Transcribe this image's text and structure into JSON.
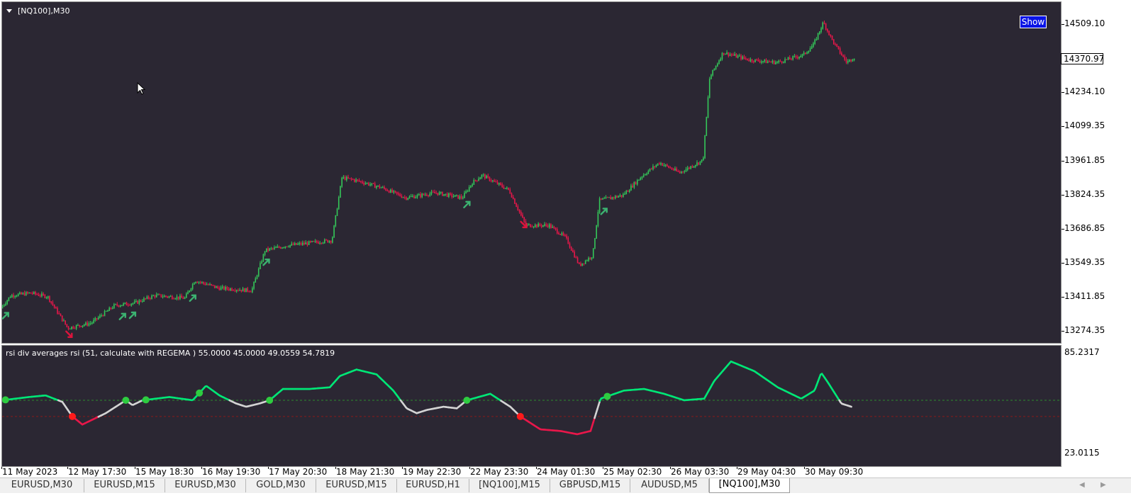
{
  "window": {
    "chart_title": "[NQ100],M30",
    "indicator_title": "rsi div averages rsi (51, calculate with  REGEMA ) 55.0000 45.0000 49.0559 54.7819",
    "show_label": "Show",
    "current_price": "14370.97"
  },
  "price_axis": {
    "labels": [
      "14509.10",
      "14370.97",
      "14234.10",
      "14099.35",
      "13961.85",
      "13824.35",
      "13686.85",
      "13549.35",
      "13411.85",
      "13274.35"
    ]
  },
  "indicator_axis": {
    "labels": [
      "85.2317",
      "23.0115"
    ],
    "max": 85.2317,
    "min": 23.0115,
    "upper_level": 55.0,
    "lower_level": 45.0
  },
  "time_axis": {
    "labels": [
      "11 May 2023",
      "12 May 17:30",
      "15 May 18:30",
      "16 May 19:30",
      "17 May 20:30",
      "18 May 21:30",
      "19 May 22:30",
      "22 May 23:30",
      "24 May 01:30",
      "25 May 02:30",
      "26 May 03:30",
      "29 May 04:30",
      "30 May 09:30"
    ]
  },
  "tabs": [
    {
      "label": "EURUSD,M30",
      "active": false
    },
    {
      "label": "EURUSD,M15",
      "active": false
    },
    {
      "label": "EURUSD,M30",
      "active": false
    },
    {
      "label": "GOLD,M30",
      "active": false
    },
    {
      "label": "EURUSD,M15",
      "active": false
    },
    {
      "label": "EURUSD,H1",
      "active": false
    },
    {
      "label": "[NQ100],M15",
      "active": false
    },
    {
      "label": "GBPUSD,M15",
      "active": false
    },
    {
      "label": "AUDUSD,M5",
      "active": false
    },
    {
      "label": "[NQ100],M30",
      "active": true
    }
  ],
  "colors": {
    "background": "#2b2733",
    "bull": "#34c759",
    "bear": "#e8174a",
    "buy_arrow": "#3cb371",
    "sell_arrow": "#dc143c",
    "rsi_bull": "#00e676",
    "rsi_neutral": "#d3d3d3",
    "rsi_bear": "#e8174a",
    "level_upper": "#2e8b2e",
    "level_lower": "#8b1a1a"
  },
  "chart_data": [
    {
      "type": "candlestick",
      "title": "[NQ100],M30",
      "ylim": [
        13230,
        14590
      ],
      "x": [
        "11 May 2023",
        "12 May 17:30",
        "15 May 18:30",
        "16 May 19:30",
        "17 May 20:30",
        "18 May 21:30",
        "19 May 22:30",
        "22 May 23:30",
        "24 May 01:30",
        "25 May 02:30",
        "26 May 03:30",
        "29 May 04:30",
        "30 May 09:30"
      ],
      "price_path": [
        [
          0,
          13370
        ],
        [
          0.15,
          13420
        ],
        [
          0.45,
          13430
        ],
        [
          0.7,
          13415
        ],
        [
          1.0,
          13290
        ],
        [
          1.35,
          13310
        ],
        [
          1.7,
          13380
        ],
        [
          2.0,
          13390
        ],
        [
          2.3,
          13420
        ],
        [
          2.75,
          13410
        ],
        [
          2.9,
          13480
        ],
        [
          3.25,
          13450
        ],
        [
          3.75,
          13440
        ],
        [
          3.95,
          13600
        ],
        [
          4.3,
          13620
        ],
        [
          4.95,
          13640
        ],
        [
          5.1,
          13890
        ],
        [
          5.3,
          13880
        ],
        [
          5.7,
          13850
        ],
        [
          6.05,
          13810
        ],
        [
          6.5,
          13830
        ],
        [
          6.9,
          13810
        ],
        [
          7.05,
          13870
        ],
        [
          7.2,
          13900
        ],
        [
          7.6,
          13840
        ],
        [
          7.85,
          13700
        ],
        [
          8.2,
          13700
        ],
        [
          8.45,
          13650
        ],
        [
          8.65,
          13540
        ],
        [
          8.85,
          13580
        ],
        [
          8.95,
          13800
        ],
        [
          9.3,
          13820
        ],
        [
          9.6,
          13900
        ],
        [
          9.85,
          13950
        ],
        [
          10.15,
          13910
        ],
        [
          10.5,
          13960
        ],
        [
          10.6,
          14290
        ],
        [
          10.8,
          14390
        ],
        [
          11.2,
          14360
        ],
        [
          11.6,
          14350
        ],
        [
          12.0,
          14380
        ],
        [
          12.15,
          14420
        ],
        [
          12.3,
          14510
        ],
        [
          12.45,
          14430
        ],
        [
          12.65,
          14350
        ],
        [
          12.75,
          14370
        ]
      ],
      "buy_arrows": [
        0.05,
        1.8,
        1.95,
        2.85,
        3.95,
        6.95,
        9.0
      ],
      "sell_arrows": [
        1.0,
        7.8
      ]
    },
    {
      "type": "line",
      "title": "rsi div averages rsi (51, calculate with  REGEMA ) 55.0000 45.0000 49.0559 54.7819",
      "ylim": [
        23.0115,
        85.2317
      ],
      "levels": [
        55.0,
        45.0
      ],
      "x": [
        "11 May 2023",
        "12 May 17:30",
        "15 May 18:30",
        "16 May 19:30",
        "17 May 20:30",
        "18 May 21:30",
        "19 May 22:30",
        "22 May 23:30",
        "24 May 01:30",
        "25 May 02:30",
        "26 May 03:30",
        "29 May 04:30",
        "30 May 09:30"
      ],
      "rsi_path": [
        [
          0,
          55
        ],
        [
          0.4,
          57
        ],
        [
          0.65,
          58
        ],
        [
          0.9,
          54
        ],
        [
          1.05,
          45
        ],
        [
          1.2,
          40
        ],
        [
          1.55,
          47
        ],
        [
          1.85,
          55
        ],
        [
          1.95,
          52
        ],
        [
          2.1,
          55
        ],
        [
          2.5,
          57
        ],
        [
          2.85,
          55
        ],
        [
          3.05,
          64
        ],
        [
          3.25,
          58
        ],
        [
          3.5,
          53
        ],
        [
          3.65,
          51
        ],
        [
          3.85,
          53
        ],
        [
          4.0,
          55
        ],
        [
          4.2,
          62
        ],
        [
          4.6,
          62
        ],
        [
          4.9,
          63
        ],
        [
          5.05,
          70
        ],
        [
          5.3,
          74
        ],
        [
          5.6,
          71
        ],
        [
          5.85,
          61
        ],
        [
          6.05,
          50
        ],
        [
          6.2,
          47
        ],
        [
          6.35,
          49
        ],
        [
          6.6,
          51
        ],
        [
          6.8,
          50
        ],
        [
          6.95,
          55
        ],
        [
          7.3,
          59
        ],
        [
          7.6,
          51
        ],
        [
          7.75,
          45
        ],
        [
          8.05,
          37
        ],
        [
          8.35,
          36
        ],
        [
          8.6,
          34
        ],
        [
          8.8,
          36
        ],
        [
          8.95,
          56
        ],
        [
          9.3,
          61
        ],
        [
          9.6,
          62
        ],
        [
          9.9,
          59
        ],
        [
          10.2,
          55
        ],
        [
          10.5,
          56
        ],
        [
          10.65,
          67
        ],
        [
          10.9,
          79
        ],
        [
          11.25,
          73
        ],
        [
          11.6,
          63
        ],
        [
          11.95,
          56
        ],
        [
          12.15,
          61
        ],
        [
          12.25,
          72
        ],
        [
          12.35,
          66
        ],
        [
          12.55,
          53
        ],
        [
          12.7,
          51
        ]
      ],
      "signal_dots": [
        {
          "x": 0.05,
          "color": "bull"
        },
        {
          "x": 1.05,
          "color": "bear"
        },
        {
          "x": 1.85,
          "color": "bull"
        },
        {
          "x": 2.15,
          "color": "bull"
        },
        {
          "x": 2.95,
          "color": "bull"
        },
        {
          "x": 4.0,
          "color": "bull"
        },
        {
          "x": 6.95,
          "color": "bull"
        },
        {
          "x": 7.75,
          "color": "bear"
        },
        {
          "x": 9.05,
          "color": "bull"
        }
      ]
    }
  ]
}
